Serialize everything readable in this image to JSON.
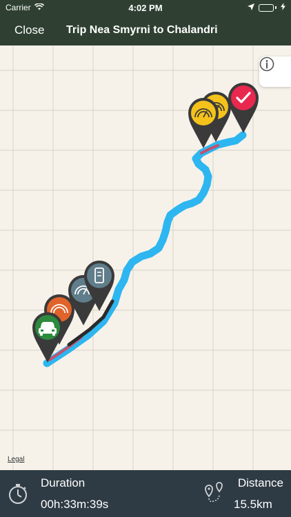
{
  "status_bar": {
    "carrier": "Carrier",
    "time": "4:02 PM",
    "icons": [
      "wifi-icon",
      "location-arrow-icon",
      "battery-icon",
      "charging-icon"
    ]
  },
  "nav": {
    "close_label": "Close",
    "title": "Trip Nea Smyrni to Chalandri"
  },
  "map": {
    "legal_label": "Legal",
    "info_icon": "info-icon",
    "route_color": "#2db6f0",
    "markers": [
      {
        "name": "start-car-marker",
        "color": "#2e8b3e",
        "icon": "car-icon"
      },
      {
        "name": "harsh-braking-marker",
        "color": "#e0632a",
        "icon": "speedometer-icon"
      },
      {
        "name": "speeding-marker",
        "color": "#607d8b",
        "icon": "speedometer-icon"
      },
      {
        "name": "phone-use-marker",
        "color": "#607d8b",
        "icon": "phone-icon"
      },
      {
        "name": "speeding-marker-end-1",
        "color": "#f4c21b",
        "icon": "speedometer-icon"
      },
      {
        "name": "speeding-marker-end-2",
        "color": "#f4c21b",
        "icon": "speedometer-icon"
      },
      {
        "name": "end-check-marker",
        "color": "#e8284e",
        "icon": "check-icon"
      }
    ]
  },
  "bottom": {
    "duration_label": "Duration",
    "duration_value": "00h:33m:39s",
    "distance_label": "Distance",
    "distance_value": "15.5km"
  }
}
